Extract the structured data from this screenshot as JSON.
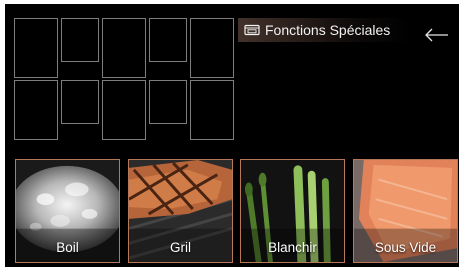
{
  "header": {
    "title": "Fonctions Spéciales",
    "icon": "oven-icon",
    "back_icon": "back-arrow-icon"
  },
  "colors": {
    "background": "#000000",
    "tile_border": "#b7785a",
    "slot_border": "#7d7d7d",
    "text": "#ffffff"
  },
  "tiles": [
    {
      "label": "Boil"
    },
    {
      "label": "Gril"
    },
    {
      "label": "Blanchir"
    },
    {
      "label": "Sous Vide"
    }
  ]
}
